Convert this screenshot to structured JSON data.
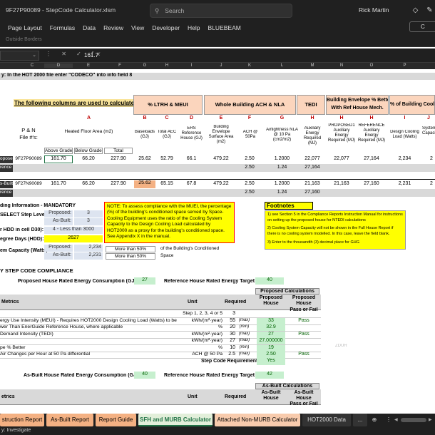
{
  "window": {
    "filename": "9F27P90089 - StepCode Calculator.xlsm",
    "search_placeholder": "Search",
    "user": "Rick Martin"
  },
  "menu": [
    "Page Layout",
    "Formulas",
    "Data",
    "Review",
    "View",
    "Developer",
    "Help",
    "BLUEBEAM"
  ],
  "menu_co": "C",
  "ribbon_hint": "Outside Borders",
  "formula_bar": {
    "value": "161.7"
  },
  "columns": [
    "C",
    "D",
    "E",
    "F",
    "G",
    "H",
    "I",
    "J",
    "K",
    "L",
    "M",
    "N",
    "O",
    "P"
  ],
  "sheet": {
    "note_top": "y:  In the HOT 2000 file enter \"CODECO\" into info field 8",
    "header_title": "The following columns are used to calculate:",
    "section_meui": "% LTRH & MEUI",
    "section_ach": "Whole Building ACH & NLA",
    "section_tedi": "TEDI",
    "section_env_1": "Building Envelope % Better",
    "section_env_2": "With Ref House Mech.",
    "section_cool": "% of Building Cool",
    "letters": [
      "A",
      "B",
      "C",
      "D",
      "E",
      "F",
      "G",
      "H",
      "H",
      "H",
      "I",
      "J"
    ],
    "pn_1": "P & N",
    "pn_2": "File #'s:",
    "heated_area": "Heated Floor Area (m2)",
    "h_baseloads": "Baseloads (GJ)",
    "h_total_aec": "Total AEC (GJ)",
    "h_erse": "ERS Reference House (GJ)",
    "h_envelope": "Building Envelope Surface Area (m2)",
    "h_ach": "ACH @ 50Pa",
    "h_airtight": "Airtightness NLA @ 10 Pa (cm2/m2)",
    "h_aux": "Auxiliary Energy Required (MJ)",
    "h_proposed_aux": "PROPOSED1 Auxiliary Energy Required (MJ)",
    "h_reference_aux": "REFERENCE Auxiliary Energy Required (MJ)",
    "h_design_cool": "Design Cooling Load (Watts)",
    "h_sys_cap": "System Capacity",
    "sub_above": "Above Grade",
    "sub_below": "Below Grade",
    "sub_total": "Total",
    "row_proposed_label": "oposed",
    "row_reference_label": "rence",
    "row_asbuilt_label": "s-Built",
    "row_reference2_label": "rence",
    "proposed_row": [
      "9F27P90089",
      "161.70",
      "66.20",
      "227.90",
      "25.62",
      "52.79",
      "66.1",
      "479.22",
      "2.50",
      "1.2000",
      "22,077",
      "22,077",
      "27,164",
      "2,234"
    ],
    "reference_row": [
      "2.50",
      "1.24",
      "27,164"
    ],
    "asbuilt_row": [
      "9F27N90089",
      "161.70",
      "66.20",
      "227.90",
      "25.62",
      "65.15",
      "67.8",
      "479.22",
      "2.50",
      "1.2000",
      "21,163",
      "21,163",
      "27,160",
      "2,231"
    ],
    "reference2_row": [
      "2.50",
      "1.24",
      "27,160"
    ],
    "sys_cap_tail_1": "2",
    "sys_cap_tail_2": "2",
    "building_info": "ding Information - MANDATORY",
    "select_step": "SELECT Step Level:",
    "hdd_cell": "r HDD in cell D30):",
    "hdd": "egree Days (HDD):",
    "capacity": "em Capacity (Watts)",
    "proposed_lbl": "Proposed:",
    "asbuilt_lbl": "As-Built:",
    "step_proposed": "3",
    "step_asbuilt": "3",
    "hdd_range": "4 - Less than 3000",
    "hdd_value": "2627",
    "cap_proposed": "2,234",
    "cap_asbuilt": "2,231",
    "more_than_1": "More than 50%",
    "more_than_2": "More than 50%",
    "of_building": "of the Building's Conditioned",
    "space": "Space",
    "note_box": "NOTE: To assess compliance with the MUEI, the percentage (%) of the building's conditioned space served by Space-Cooling Equipment uses the ratio of the Cooling System Capacity to the Design Cooling Load calculated by HOT2000 as a proxy for the building's conditioned space. See Appendix X in the manual.",
    "footnotes_title": "Footnotes",
    "footnote_1": "1) see Section 5 in the Compliance Reports Instruction Manual for instructions on setting up the proposed house for NTEDI calculations",
    "footnote_2": "2) Cooling System Capacity will not be shown in the Full House Report if there is no cooling system modelled.  In this case, leave the field blank.",
    "footnote_3": "3) Enter to the thousandth (3) decimal place for GHG",
    "compliance_title": "Y STEP CODE COMPLIANCE",
    "prop_energy_label": "Proposed House Rated Energy Consumption (GJ/year):",
    "prop_energy_value": "27",
    "ref_target_label": "Reference House Rated Energy Target (GJ/year):",
    "ref_target_value": "40",
    "proposed_calc": "Proposed Calculations",
    "metrics": "Metrics",
    "unit": "Unit",
    "required": "Required",
    "proposed_house": "Proposed House",
    "proposed_house2": "Proposed House",
    "pass_or_fail": "Pass or Fail",
    "metric_rows": [
      {
        "metric": "",
        "unit": "Step 1, 2, 3, 4 or 5",
        "req": "3",
        "max": "",
        "val": "",
        "pf": ""
      },
      {
        "metric": "ergy Use Intensity (MEUI) - Requires HOT2000 Design Cooling Load (Watts) to be en",
        "unit": "kWh/(m²·year)",
        "req": "55",
        "max": "(max)",
        "val": "33",
        "pf": "Pass"
      },
      {
        "metric": "wer Than EnerGuide Reference House, where applicable",
        "unit": "%",
        "req": "20",
        "max": "(min)",
        "val": "32.9",
        "pf": ""
      },
      {
        "metric": " Demand Intensity (TEDI)",
        "unit": "kWh/(m²·year)",
        "req": "30",
        "max": "(max)",
        "val": "27",
        "pf": "Pass"
      },
      {
        "metric": "",
        "unit": "kWh/(m²·year)",
        "req": "27",
        "max": "(max)",
        "val": "27.000000",
        "pf": ""
      },
      {
        "metric": "pe % Better",
        "unit": "%",
        "req": "10",
        "max": "(min)",
        "val": "19",
        "pf": ""
      },
      {
        "metric": " Air Changes per Hour at 50 Pa differential",
        "unit": "ACH @ 50 Pa",
        "req": "2.5",
        "max": "(max)",
        "val": "2.50",
        "pf": "Pass"
      }
    ],
    "step_met_label": "Step Code Requirements Met:",
    "step_met_value": "Yes",
    "asbuilt_energy_label": "As-Built House Rated Energy Consumption (GJ/year):",
    "asbuilt_energy_value": "40",
    "asbuilt_target_label": "Reference House Rated Energy Target (GJ/year):",
    "asbuilt_target_value": "42",
    "asbuilt_calc": "As-Built Calculations",
    "asbuilt_house": "As-Built House",
    "asbuilt_house2": "As-Built House",
    "metrics2": "etrics",
    "unit2": "Unit",
    "required2": "Required",
    "pass_or_fail2": "Pass or Fail",
    "watermark": "ZDUR"
  },
  "tabs": [
    "struction Report",
    "As-Built Report",
    "Report Guide",
    "SFH and MURB Calculator",
    "Attached Non-MURB Calculator",
    "HOT2000 Data",
    "..."
  ],
  "status": "y: Investigate"
}
